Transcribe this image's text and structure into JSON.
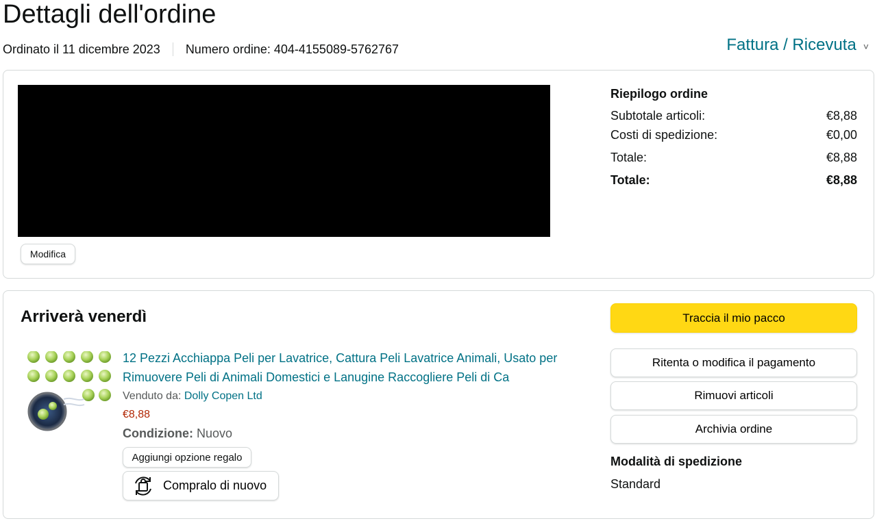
{
  "header": {
    "title": "Dettagli dell'ordine",
    "order_date": "Ordinato il 11 dicembre 2023",
    "order_number": "Numero ordine: 404-4155089-5762767",
    "invoice_link": "Fattura / Ricevuta",
    "invoice_chevron": "˅"
  },
  "address_card": {
    "edit_label": "Modifica"
  },
  "summary": {
    "title": "Riepilogo ordine",
    "rows": [
      {
        "label": "Subtotale articoli:",
        "value": "€8,88"
      },
      {
        "label": "Costi di spedizione:",
        "value": "€0,00"
      },
      {
        "label": "Totale:",
        "value": "€8,88"
      },
      {
        "label": "Totale:",
        "value": "€8,88"
      }
    ]
  },
  "shipment": {
    "arrival": "Arriverà venerdì",
    "product": {
      "title": "12 Pezzi Acchiappa Peli per Lavatrice, Cattura Peli Lavatrice Animali, Usato per Rimuovere Peli di Animali Domestici e Lanugine Raccogliere Peli di Ca",
      "seller_prefix": "Venduto da:",
      "seller_name": "Dolly Copen Ltd",
      "price": "€8,88",
      "condition_label": "Condizione:",
      "condition_value": "Nuovo",
      "gift_label": "Aggiungi opzione regalo",
      "rebuy_label": "Compralo di nuovo"
    },
    "actions": {
      "track": "Traccia il mio pacco",
      "retry_payment": "Ritenta o modifica il pagamento",
      "remove_items": "Rimuovi articoli",
      "archive": "Archivia ordine"
    },
    "shipping_method_title": "Modalità di spedizione",
    "shipping_method_value": "Standard"
  },
  "colors": {
    "link": "#007185",
    "price": "#b12704",
    "primary_button": "#ffd814",
    "border": "#d5d9d9"
  },
  "icons": {
    "rebuy": "buy-again-icon",
    "invoice_dropdown": "chevron-down-icon"
  }
}
